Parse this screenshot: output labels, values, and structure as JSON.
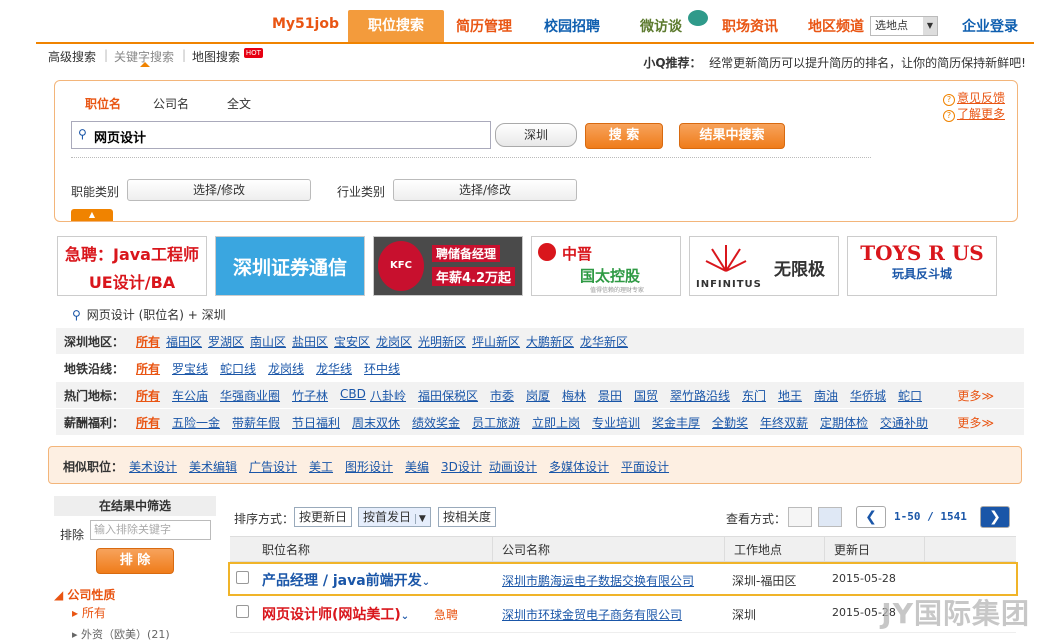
{
  "topnav": {
    "items": [
      "My51job",
      "职位搜索",
      "简历管理",
      "校园招聘",
      "微访谈",
      "职场资讯",
      "地区频道"
    ],
    "region_select": "选地点",
    "login": "企业登录"
  },
  "subnav": {
    "items": [
      "高级搜索",
      "关键字搜索",
      "地图搜索"
    ],
    "hot": "HOT",
    "rec_label": "小Q推荐：",
    "rec_text": "经常更新简历可以提升简历的排名，让你的简历保持新鲜吧!"
  },
  "search": {
    "tabs": [
      "职位名",
      "公司名",
      "全文"
    ],
    "keyword": "网页设计",
    "city": "深圳",
    "search_btn": "搜 索",
    "within_btn": "结果中搜索",
    "func_label": "职能类别",
    "func_sel": "选择/修改",
    "ind_label": "行业类别",
    "ind_sel": "选择/修改",
    "feedback": "意见反馈",
    "learn": "了解更多"
  },
  "banners": [
    {
      "l1": "急聘：Java工程师",
      "l2": "UE设计/BA",
      "colors": {
        "bg": "#ffffff",
        "text": "#d9161c"
      }
    },
    {
      "l1": "深圳证券通信",
      "colors": {
        "bg": "#3aa6e0",
        "text": "#ffffff"
      }
    },
    {
      "logo": "KFC",
      "l1": "聘储备经理",
      "l2": "年薪4.2万起",
      "colors": {
        "bg": "#4a4a4a",
        "text": "#ffffff"
      }
    },
    {
      "l1": "中晋",
      "l2": "国太控股",
      "l3": "值得信赖的理财专家",
      "colors": {
        "bg": "#ffffff",
        "text": "#2f9a44"
      }
    },
    {
      "l1": "INFINITUS",
      "l2": "无限极",
      "colors": {
        "bg": "#ffffff",
        "text": "#333333"
      }
    },
    {
      "l1": "TOYS R US",
      "l2": "玩具反斗城",
      "colors": {
        "bg": "#ffffff",
        "text": "#d9161c"
      }
    }
  ],
  "crumb": "网页设计 (职位名) + 深圳",
  "filters": [
    {
      "hd": "深圳地区：",
      "all": "所有",
      "items": [
        "福田区",
        "罗湖区",
        "南山区",
        "盐田区",
        "宝安区",
        "龙岗区",
        "光明新区",
        "坪山新区",
        "大鹏新区",
        "龙华新区"
      ]
    },
    {
      "hd": "地铁沿线：",
      "all": "所有",
      "items": [
        "罗宝线",
        "蛇口线",
        "龙岗线",
        "龙华线",
        "环中线"
      ]
    },
    {
      "hd": "热门地标：",
      "all": "所有",
      "items": [
        "车公庙",
        "华强商业圈",
        "竹子林",
        "CBD",
        "八卦岭",
        "福田保税区",
        "市委",
        "岗厦",
        "梅林",
        "景田",
        "国贸",
        "翠竹路沿线",
        "东门",
        "地王",
        "南油",
        "华侨城",
        "蛇口"
      ],
      "more": "更多"
    },
    {
      "hd": "薪酬福利：",
      "all": "所有",
      "items": [
        "五险一金",
        "带薪年假",
        "节日福利",
        "周末双休",
        "绩效奖金",
        "员工旅游",
        "立即上岗",
        "专业培训",
        "奖金丰厚",
        "全勤奖",
        "年终双薪",
        "定期体检",
        "交通补助"
      ],
      "more": "更多"
    }
  ],
  "similar": {
    "hd": "相似职位：",
    "items": [
      "美术设计",
      "美术编辑",
      "广告设计",
      "美工",
      "图形设计",
      "美编",
      "3D设计",
      "动画设计",
      "多媒体设计",
      "平面设计"
    ]
  },
  "sidebar": {
    "title": "在结果中筛选",
    "exclude_label": "排除",
    "exclude_placeholder": "输入排除关键字",
    "exclude_btn": "排 除",
    "cat": "公司性质",
    "sub1": "所有",
    "sub2": "外资（欧美）(21)"
  },
  "results": {
    "sort_label": "排序方式：",
    "sort_opts": [
      "按更新日",
      "按首发日",
      "按相关度"
    ],
    "view_label": "查看方式：",
    "pager": "1-50 / 1541",
    "cols": [
      "职位名称",
      "公司名称",
      "工作地点",
      "更新日"
    ],
    "rows": [
      {
        "job": "产品经理 / java前端开发",
        "urgent": "",
        "company": "深圳市鹏海运电子数据交换有限公司",
        "loc": "深圳-福田区",
        "date": "2015-05-28",
        "color": "#1a56a8"
      },
      {
        "job": "网页设计师(网站美工)",
        "urgent": "急聘",
        "company": "深圳市环球金贸电子商务有限公司",
        "loc": "深圳",
        "date": "2015-05-28",
        "color": "#d9161c"
      }
    ]
  },
  "watermark": "JY国际集团"
}
